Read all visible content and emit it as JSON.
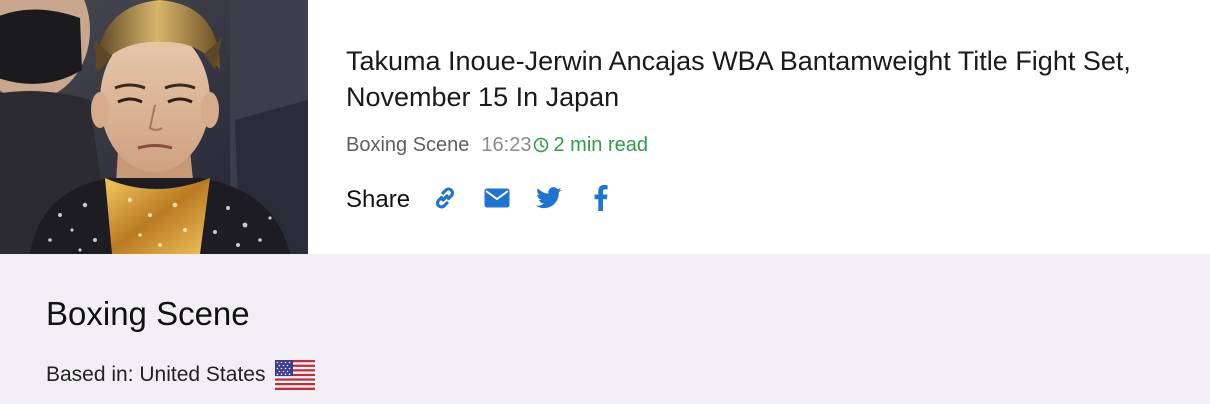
{
  "article": {
    "headline": "Takuma Inoue-Jerwin Ancajas WBA Bantamweight Title Fight Set, November 15 In Japan",
    "source": "Boxing Scene",
    "time": "16:23",
    "read_time": "2 min read",
    "image_alt": "Takuma Inoue"
  },
  "share": {
    "label": "Share",
    "buttons": [
      {
        "name": "copy-link",
        "icon": "link-icon"
      },
      {
        "name": "email",
        "icon": "envelope-icon"
      },
      {
        "name": "twitter",
        "icon": "twitter-icon"
      },
      {
        "name": "facebook",
        "icon": "facebook-icon"
      }
    ]
  },
  "publisher": {
    "name": "Boxing Scene",
    "based_label": "Based in: United States",
    "flag": "us-flag-icon"
  },
  "colors": {
    "accent_blue": "#1e74d0",
    "read_green": "#2e9c4a",
    "footer_bg": "#f1eff3"
  }
}
